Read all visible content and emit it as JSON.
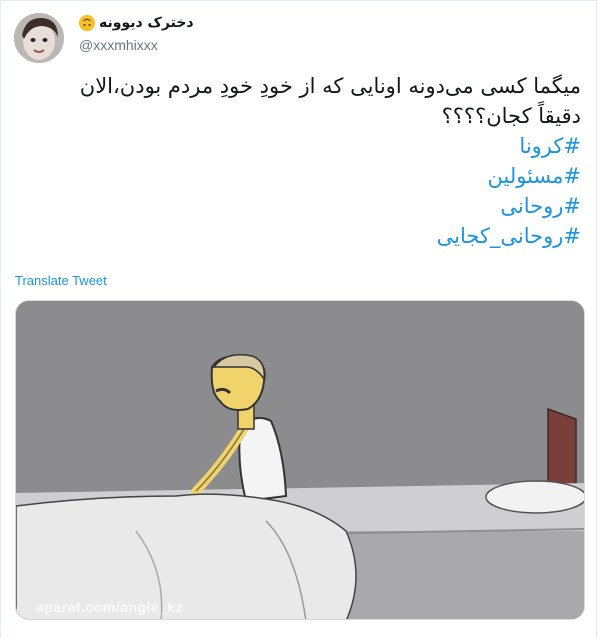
{
  "user": {
    "display_name": "دخترک دیوونه",
    "handle": "@xxxmhixxx",
    "emoji": "upside-down-face-emoji"
  },
  "tweet": {
    "lines": [
      "میگما کسی می‌دونه اونایی که از خودِ خودِ مردم بودن،الان",
      "دقیقاً کجان؟؟؟؟"
    ],
    "hashtags": [
      "#کرونا",
      "#مسئولین",
      "#روحانی",
      "#روحانی_کجایی"
    ],
    "translate_label": "Translate Tweet"
  },
  "media": {
    "watermark": "aparat.com/angle_kz"
  },
  "colors": {
    "link": "#1b95e0",
    "text": "#14171a",
    "secondary": "#657786"
  }
}
